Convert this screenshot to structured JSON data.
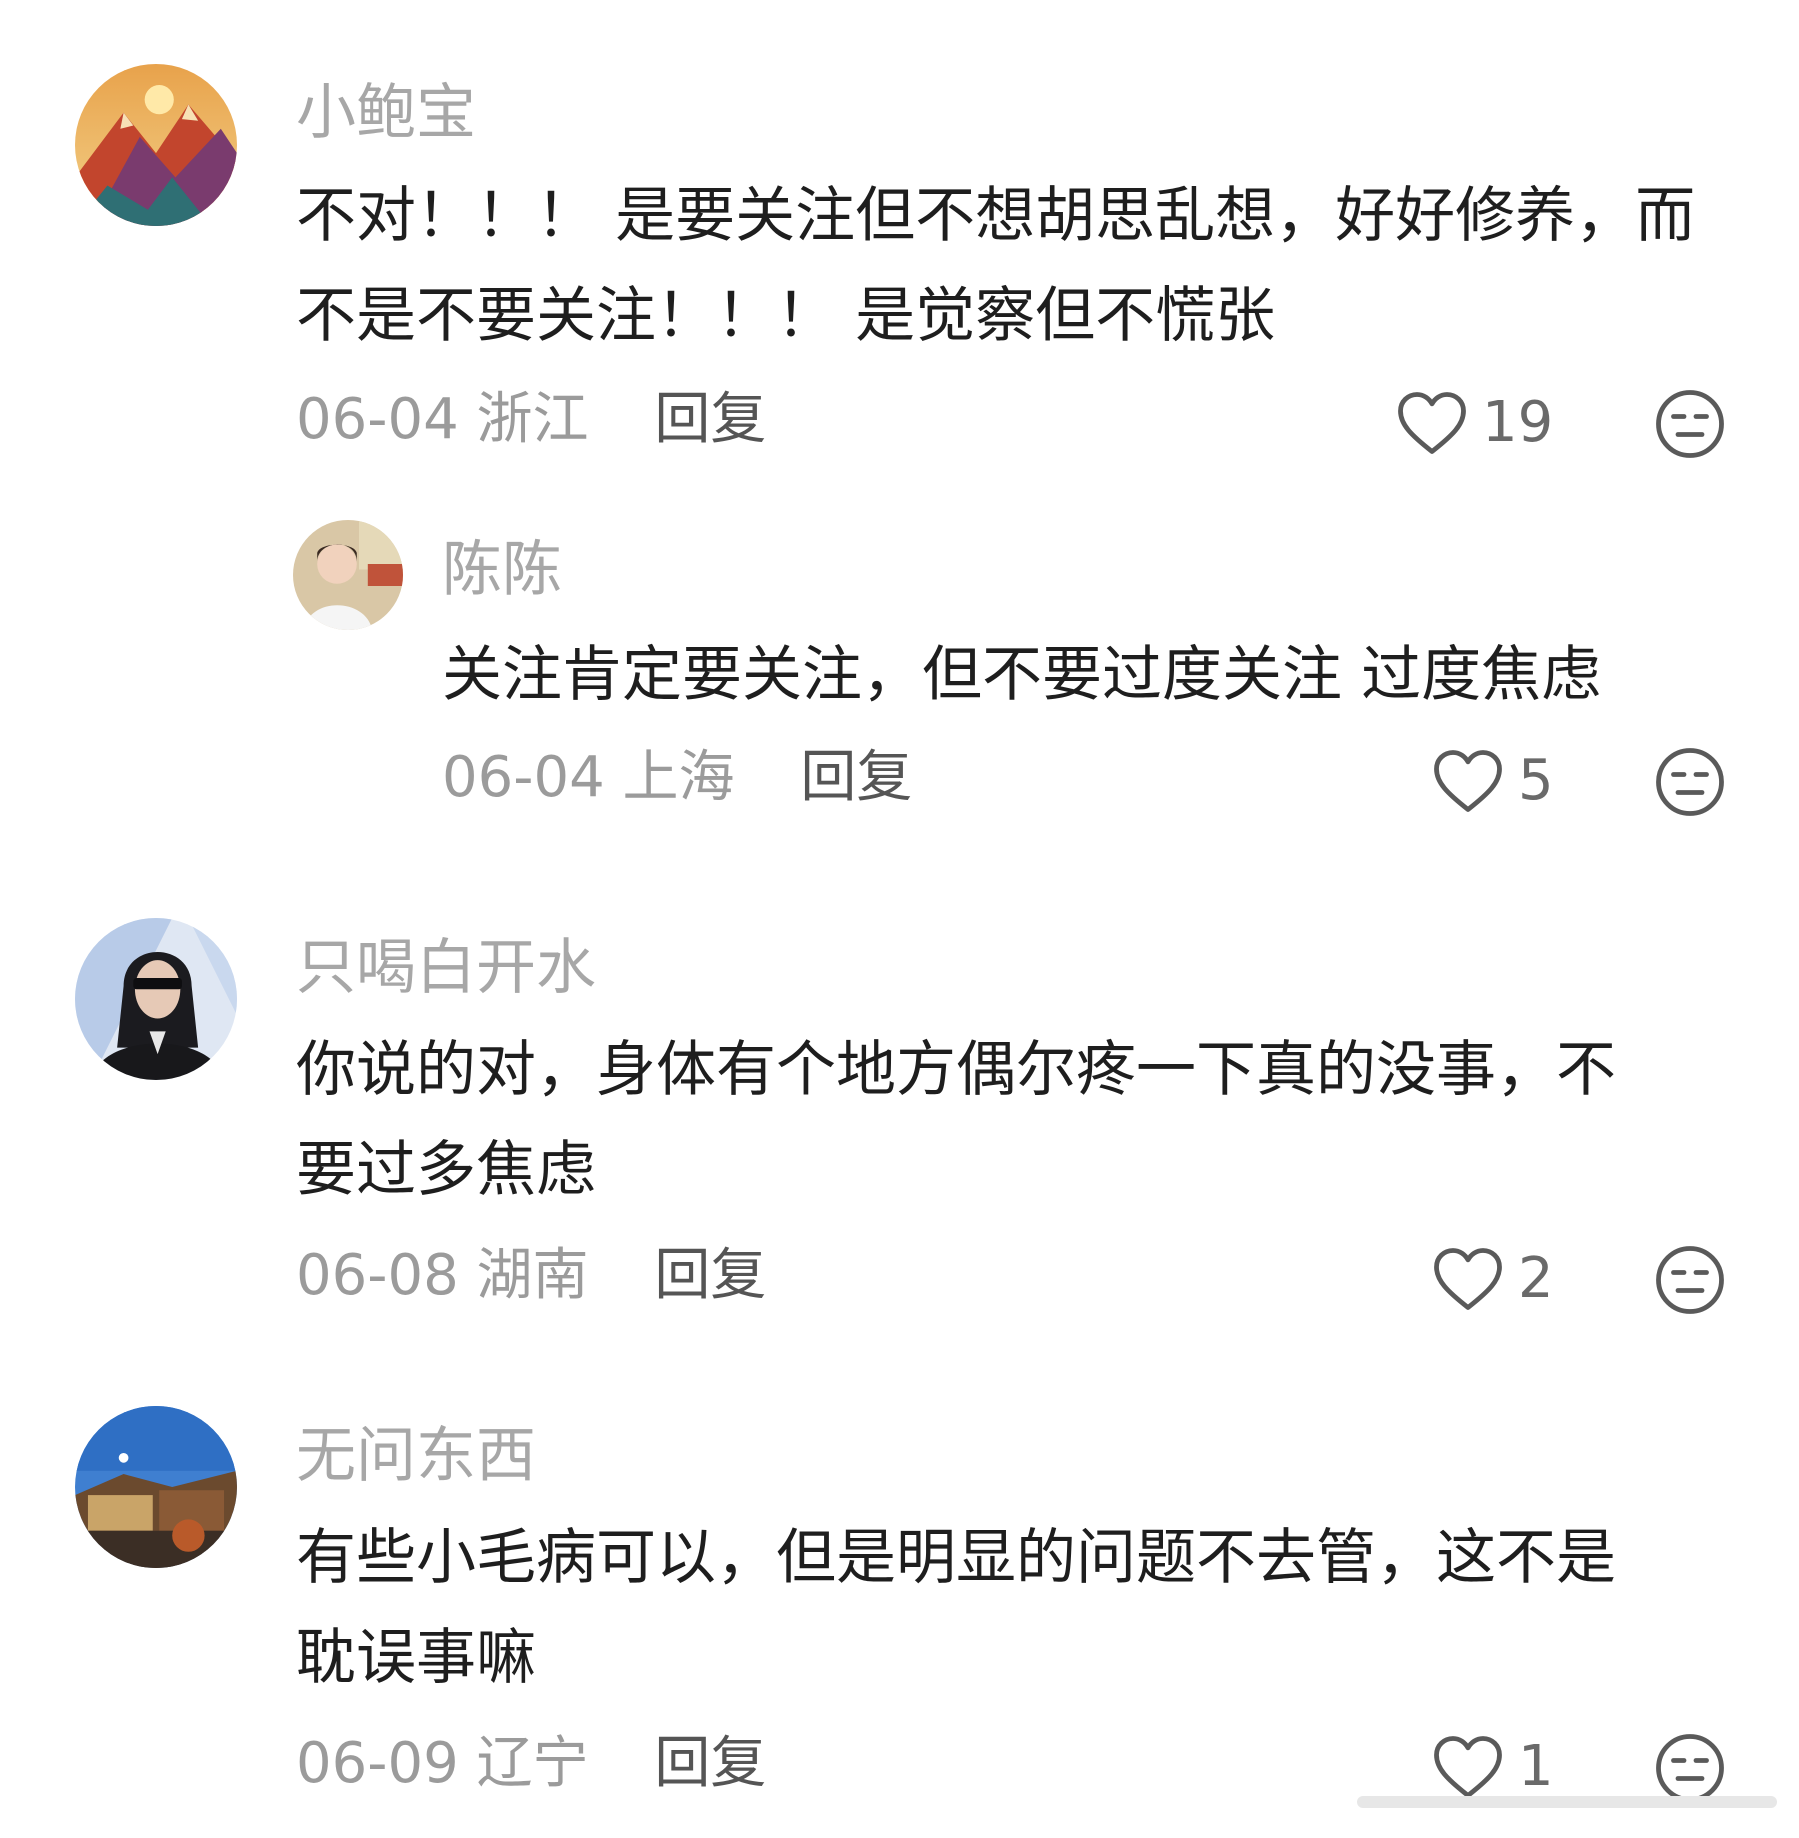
{
  "comments": [
    {
      "username": "小鲍宝",
      "text_lines": [
        "不对！！！ 是要关注但不想胡思乱想，好好修养，而",
        "不是不要关注！！！ 是觉察但不慌张"
      ],
      "date": "06-04",
      "location": "浙江",
      "reply_label": "回复",
      "likes": "19",
      "avatar_icon": "mountain-sunset-avatar"
    },
    {
      "username": "陈陈",
      "text_lines": [
        "关注肯定要关注，但不要过度关注 过度焦虑"
      ],
      "date": "06-04",
      "location": "上海",
      "reply_label": "回复",
      "likes": "5",
      "avatar_icon": "person-photo-avatar"
    },
    {
      "username": "只喝白开水",
      "text_lines": [
        "你说的对，身体有个地方偶尔疼一下真的没事，不",
        "要过多焦虑"
      ],
      "date": "06-08",
      "location": "湖南",
      "reply_label": "回复",
      "likes": "2",
      "avatar_icon": "sunglasses-person-avatar"
    },
    {
      "username": "无问东西",
      "text_lines": [
        "有些小毛病可以，但是明显的问题不去管，这不是",
        "耽误事嘛"
      ],
      "date": "06-09",
      "location": "辽宁",
      "reply_label": "回复",
      "likes": "1",
      "avatar_icon": "old-town-avatar"
    }
  ],
  "colors": {
    "username": "#a7a7a7",
    "text": "#1e1e1e",
    "meta": "#9b9b9b",
    "reply": "#555555",
    "icon": "#5a5a5a"
  },
  "icons": {
    "like": "heart-outline-icon",
    "dislike": "neutral-face-icon"
  }
}
